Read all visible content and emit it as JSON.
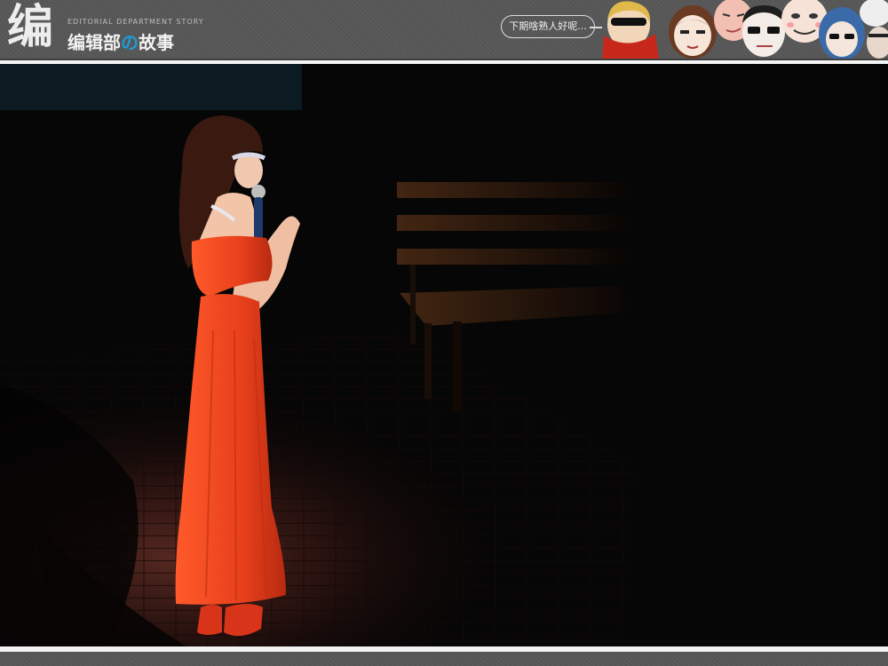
{
  "header": {
    "logo_mark": "编",
    "subtitle": "EDITORIAL DEPARTMENT STORY",
    "title_part1": "编辑部",
    "title_no": "の",
    "title_part2": "故事",
    "speech_bubble": "下期啥熟人好呢..."
  },
  "colors": {
    "header_bg": "#555555",
    "accent_blue": "#1c9bd8",
    "dress_red": "#e83a18",
    "floor_brick": "#3a1a16"
  },
  "photo": {
    "subject": "woman-in-red-dress-on-stage",
    "props": [
      "microphone",
      "wooden-bench"
    ]
  }
}
